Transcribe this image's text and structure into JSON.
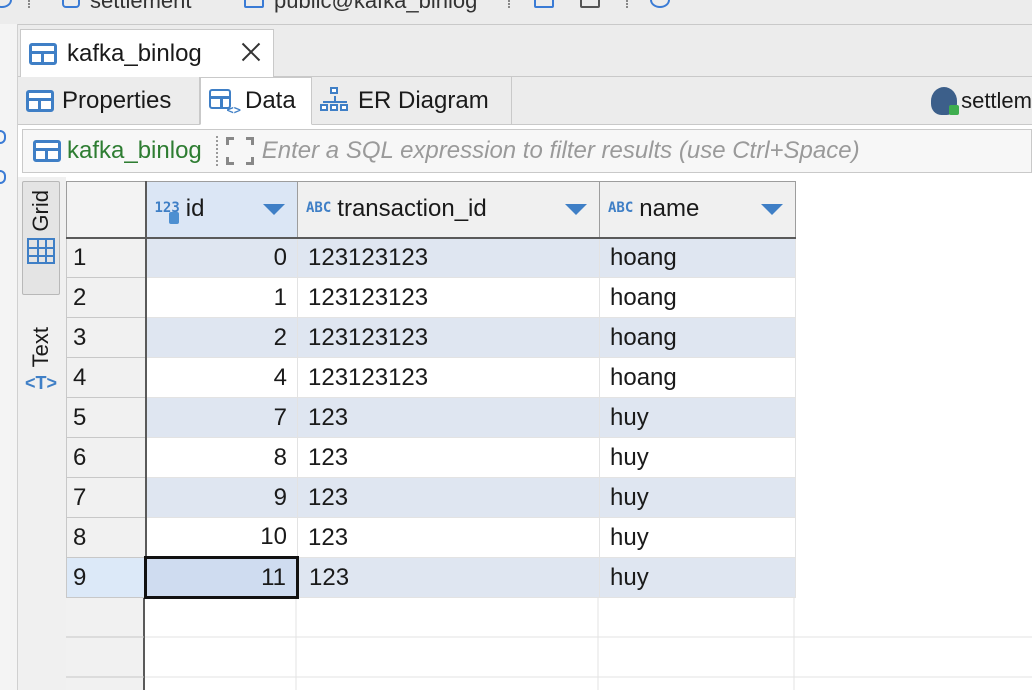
{
  "toolbar": {
    "frag1": "settlement",
    "frag2": "public@kafka_binlog"
  },
  "editor_tab": {
    "label": "kafka_binlog"
  },
  "sub_tabs": [
    {
      "label": "Properties",
      "active": false
    },
    {
      "label": "Data",
      "active": true
    },
    {
      "label": "ER Diagram",
      "active": false
    }
  ],
  "connection": {
    "label": "settlem"
  },
  "filter": {
    "table_name": "kafka_binlog",
    "placeholder": "Enter a SQL expression to filter results (use Ctrl+Space)"
  },
  "view_switch": {
    "grid_label": "Grid",
    "text_label": "Text"
  },
  "columns": [
    {
      "name": "id",
      "type_icon": "123"
    },
    {
      "name": "transaction_id",
      "type_icon": "ABC"
    },
    {
      "name": "name",
      "type_icon": "ABC"
    }
  ],
  "rows": [
    {
      "n": "1",
      "id": "0",
      "transaction_id": "123123123",
      "name": "hoang"
    },
    {
      "n": "2",
      "id": "1",
      "transaction_id": "123123123",
      "name": "hoang"
    },
    {
      "n": "3",
      "id": "2",
      "transaction_id": "123123123",
      "name": "hoang"
    },
    {
      "n": "4",
      "id": "4",
      "transaction_id": "123123123",
      "name": "hoang"
    },
    {
      "n": "5",
      "id": "7",
      "transaction_id": "123",
      "name": "huy"
    },
    {
      "n": "6",
      "id": "8",
      "transaction_id": "123",
      "name": "huy"
    },
    {
      "n": "7",
      "id": "9",
      "transaction_id": "123",
      "name": "huy"
    },
    {
      "n": "8",
      "id": "10",
      "transaction_id": "123",
      "name": "huy"
    },
    {
      "n": "9",
      "id": "11",
      "transaction_id": "123",
      "name": "huy"
    }
  ],
  "colors": {
    "accent": "#3f7fc6",
    "row_alt": "#dfe6f1",
    "table_name_green": "#2e7d32"
  }
}
